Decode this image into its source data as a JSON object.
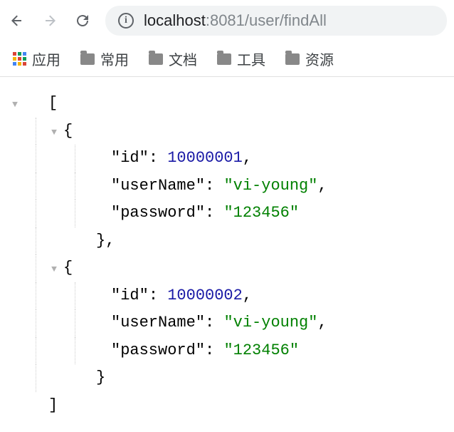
{
  "url": {
    "host": "localhost",
    "port": ":8081",
    "path": "/user/findAll"
  },
  "bookmarks": {
    "apps": "应用",
    "items": [
      "常用",
      "文档",
      "工具",
      "资源"
    ]
  },
  "json_body": [
    {
      "id": 10000001,
      "userName": "vi-young",
      "password": "123456"
    },
    {
      "id": 10000002,
      "userName": "vi-young",
      "password": "123456"
    }
  ],
  "keys": {
    "id": "\"id\"",
    "userName": "\"userName\"",
    "password": "\"password\""
  },
  "vals": {
    "id0": "10000001",
    "userName0": "\"vi-young\"",
    "password0": "\"123456\"",
    "id1": "10000002",
    "userName1": "\"vi-young\"",
    "password1": "\"123456\""
  }
}
